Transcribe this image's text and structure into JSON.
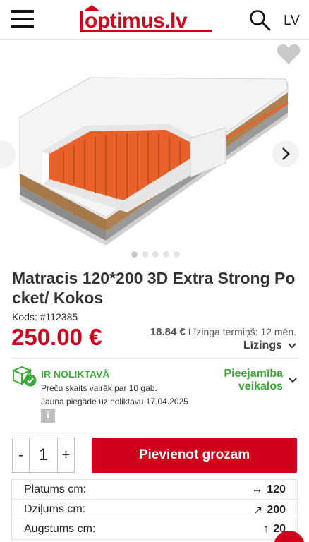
{
  "header": {
    "logo_text": "optimus.lv",
    "lang": "LV"
  },
  "gallery": {
    "slides_total": 5,
    "active_slide": 1
  },
  "product": {
    "title": "Matracis 120*200 3D Extra Strong Po cket/ Kokos",
    "code": "Kods: #112385",
    "price": "250.00 €",
    "lease_amount": "18.84 €",
    "lease_text": "Līzinga termiņš: 12 mēn.",
    "lizings_label": "Līzings"
  },
  "stock": {
    "status": "IR NOLIKTAVĀ",
    "note": "Preču skaits vairāk par 10 gab.",
    "delivery": "Jauna piegāde uz noliktavu 17.04.2025",
    "info": "i",
    "availability_line1": "Pieejamība",
    "availability_line2": "veikalos"
  },
  "cart": {
    "minus": "-",
    "quantity": "1",
    "plus": "+",
    "add_label": "Pievienot grozam"
  },
  "specs": [
    {
      "label": "Platums cm:",
      "icon": "↔",
      "value": "120"
    },
    {
      "label": "Dziļums cm:",
      "icon": "↗",
      "value": "200"
    },
    {
      "label": "Augstums cm:",
      "icon": "↑",
      "value": "20"
    }
  ],
  "colors": {
    "brand_red": "#d0021b",
    "stock_green": "#3aa935"
  }
}
